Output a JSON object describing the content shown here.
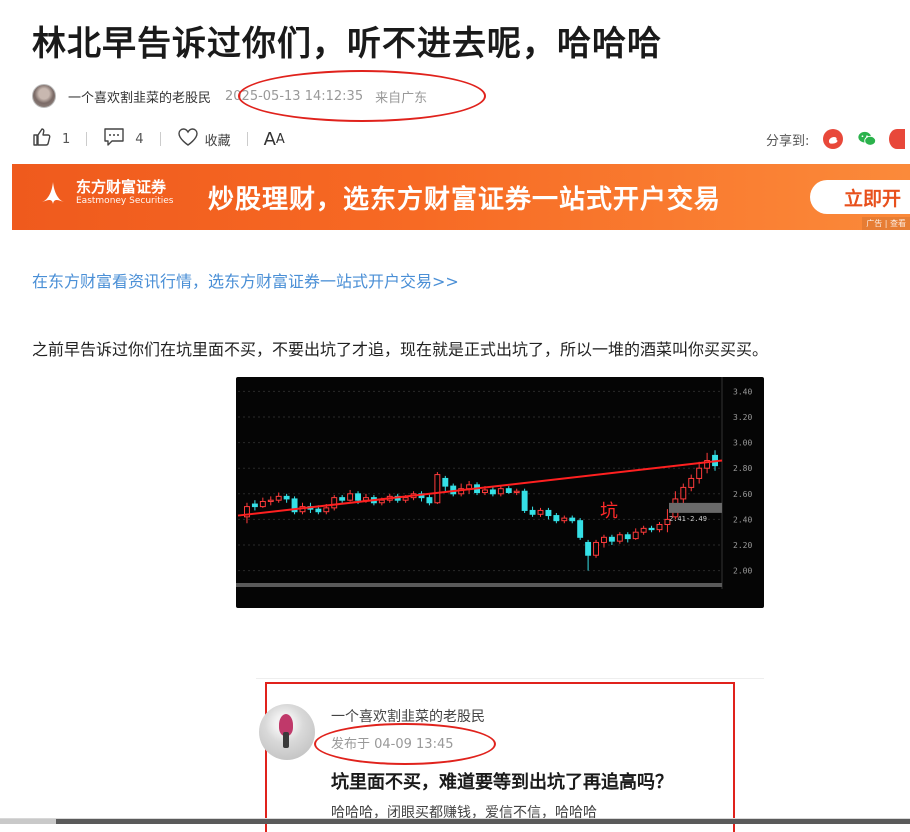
{
  "article": {
    "title": "林北早告诉过你们，听不进去呢，哈哈哈",
    "author": "一个喜欢割韭菜的老股民",
    "time": "2025-05-13 14:12:35",
    "from": "来自广东"
  },
  "toolbar": {
    "like_count": "1",
    "comment_count": "4",
    "favorite_label": "收藏",
    "font_label_big": "A",
    "font_label_small": "A"
  },
  "share": {
    "label": "分享到:"
  },
  "banner": {
    "logo_cn": "东方财富证券",
    "logo_en": "Eastmoney Securities",
    "slogan": "炒股理财，选东方财富证券一站式开户交易",
    "button": "立即开",
    "ad_tag": "广告 | 查看"
  },
  "content": {
    "link": "在东方财富看资讯行情，选东方财富证券一站式开户交易>>",
    "paragraph": "之前早告诉过你们在坑里面不买，不要出坑了才追，现在就是正式出坑了，所以一堆的酒菜叫你买买买。"
  },
  "chart_data": {
    "type": "candlestick",
    "annotation": "坑",
    "ylim": [
      1.95,
      3.45
    ],
    "y_ticks": [
      "3.40",
      "3.20",
      "3.00",
      "2.80",
      "2.60",
      "2.40",
      "2.20",
      "2.00"
    ],
    "price_tag": "2.41-2.49",
    "trendline": {
      "from": 2.43,
      "to": 2.86
    },
    "candles": [
      [
        2.42,
        2.5,
        2.37,
        2.53
      ],
      [
        2.52,
        2.5,
        2.47,
        2.55
      ],
      [
        2.5,
        2.54,
        2.49,
        2.57
      ],
      [
        2.54,
        2.55,
        2.51,
        2.58
      ],
      [
        2.55,
        2.58,
        2.53,
        2.61
      ],
      [
        2.58,
        2.56,
        2.53,
        2.6
      ],
      [
        2.56,
        2.46,
        2.44,
        2.58
      ],
      [
        2.46,
        2.5,
        2.44,
        2.53
      ],
      [
        2.5,
        2.48,
        2.45,
        2.53
      ],
      [
        2.48,
        2.46,
        2.44,
        2.51
      ],
      [
        2.46,
        2.49,
        2.44,
        2.52
      ],
      [
        2.49,
        2.57,
        2.47,
        2.59
      ],
      [
        2.57,
        2.55,
        2.53,
        2.59
      ],
      [
        2.55,
        2.6,
        2.54,
        2.63
      ],
      [
        2.6,
        2.55,
        2.52,
        2.62
      ],
      [
        2.55,
        2.57,
        2.53,
        2.6
      ],
      [
        2.57,
        2.53,
        2.51,
        2.59
      ],
      [
        2.53,
        2.55,
        2.51,
        2.57
      ],
      [
        2.55,
        2.58,
        2.53,
        2.6
      ],
      [
        2.58,
        2.55,
        2.53,
        2.6
      ],
      [
        2.55,
        2.57,
        2.53,
        2.59
      ],
      [
        2.57,
        2.6,
        2.55,
        2.62
      ],
      [
        2.6,
        2.57,
        2.54,
        2.62
      ],
      [
        2.57,
        2.53,
        2.51,
        2.6
      ],
      [
        2.53,
        2.75,
        2.52,
        2.77
      ],
      [
        2.72,
        2.66,
        2.62,
        2.74
      ],
      [
        2.66,
        2.6,
        2.58,
        2.68
      ],
      [
        2.6,
        2.64,
        2.58,
        2.68
      ],
      [
        2.64,
        2.67,
        2.6,
        2.7
      ],
      [
        2.67,
        2.61,
        2.59,
        2.69
      ],
      [
        2.61,
        2.63,
        2.59,
        2.66
      ],
      [
        2.63,
        2.6,
        2.58,
        2.65
      ],
      [
        2.6,
        2.64,
        2.58,
        2.66
      ],
      [
        2.64,
        2.61,
        2.6,
        2.66
      ],
      [
        2.61,
        2.62,
        2.59,
        2.64
      ],
      [
        2.62,
        2.47,
        2.45,
        2.64
      ],
      [
        2.47,
        2.44,
        2.42,
        2.5
      ],
      [
        2.44,
        2.47,
        2.42,
        2.49
      ],
      [
        2.47,
        2.43,
        2.4,
        2.49
      ],
      [
        2.43,
        2.39,
        2.37,
        2.45
      ],
      [
        2.39,
        2.41,
        2.37,
        2.43
      ],
      [
        2.41,
        2.39,
        2.37,
        2.43
      ],
      [
        2.39,
        2.26,
        2.24,
        2.41
      ],
      [
        2.22,
        2.12,
        2.0,
        2.24
      ],
      [
        2.12,
        2.22,
        2.1,
        2.24
      ],
      [
        2.22,
        2.26,
        2.18,
        2.28
      ],
      [
        2.26,
        2.23,
        2.2,
        2.28
      ],
      [
        2.23,
        2.28,
        2.21,
        2.3
      ],
      [
        2.28,
        2.25,
        2.22,
        2.3
      ],
      [
        2.25,
        2.3,
        2.24,
        2.33
      ],
      [
        2.3,
        2.33,
        2.28,
        2.35
      ],
      [
        2.33,
        2.32,
        2.3,
        2.35
      ],
      [
        2.32,
        2.36,
        2.3,
        2.38
      ],
      [
        2.36,
        2.4,
        2.3,
        2.48
      ],
      [
        2.42,
        2.56,
        2.4,
        2.62
      ],
      [
        2.56,
        2.65,
        2.52,
        2.68
      ],
      [
        2.65,
        2.72,
        2.62,
        2.75
      ],
      [
        2.72,
        2.8,
        2.68,
        2.85
      ],
      [
        2.8,
        2.86,
        2.76,
        2.92
      ],
      [
        2.9,
        2.82,
        2.78,
        2.94
      ]
    ]
  },
  "card": {
    "author": "一个喜欢割韭菜的老股民",
    "time": "发布于 04-09 13:45",
    "title": "坑里面不买，难道要等到出坑了再追高吗？",
    "body": "哈哈哈，闭眼买都赚钱，爱信不信，哈哈哈"
  }
}
